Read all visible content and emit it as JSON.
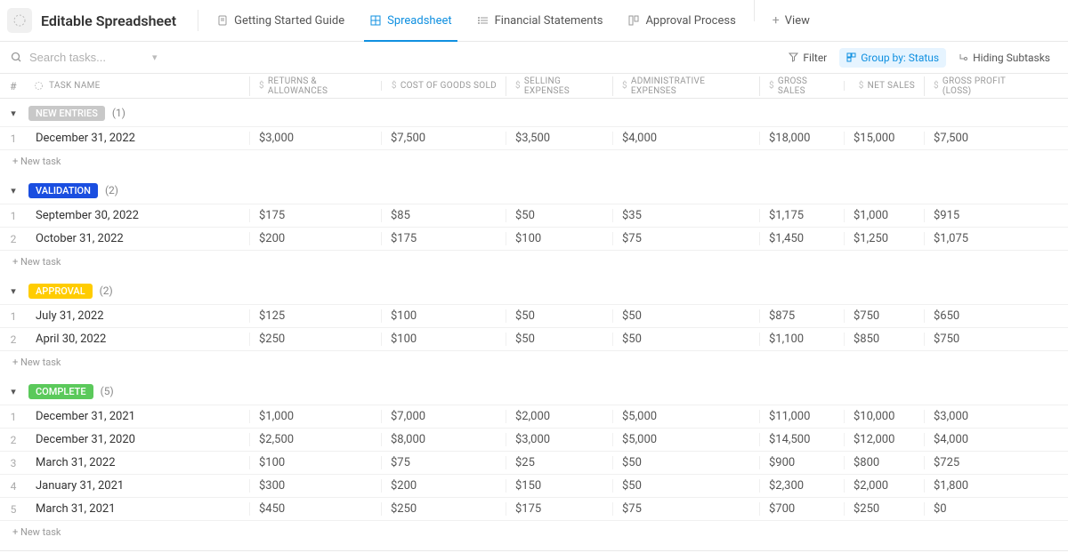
{
  "header": {
    "title": "Editable Spreadsheet",
    "tabs": [
      {
        "label": "Getting Started Guide"
      },
      {
        "label": "Spreadsheet"
      },
      {
        "label": "Financial Statements"
      },
      {
        "label": "Approval Process"
      },
      {
        "label": "View"
      }
    ]
  },
  "subbar": {
    "search_placeholder": "Search tasks...",
    "filter": "Filter",
    "groupby": "Group by: Status",
    "hiding": "Hiding Subtasks"
  },
  "columns": {
    "num": "#",
    "task": "TASK NAME",
    "ra": "RETURNS & ALLOWANCES",
    "cogs": "COST OF GOODS SOLD",
    "se": "SELLING EXPENSES",
    "ae": "ADMINISTRATIVE EXPENSES",
    "gs": "GROSS SALES",
    "ns": "NET SALES",
    "gp": "GROSS PROFIT (LOSS)"
  },
  "new_task_label": "+ New task",
  "groups": [
    {
      "name": "NEW ENTRIES",
      "badge_class": "gray",
      "count": "(1)",
      "rows": [
        {
          "n": "1",
          "task": "December 31, 2022",
          "ra": "$3,000",
          "cogs": "$7,500",
          "se": "$3,500",
          "ae": "$4,000",
          "gs": "$18,000",
          "ns": "$15,000",
          "gp": "$7,500"
        }
      ]
    },
    {
      "name": "VALIDATION",
      "badge_class": "blue",
      "count": "(2)",
      "rows": [
        {
          "n": "1",
          "task": "September 30, 2022",
          "ra": "$175",
          "cogs": "$85",
          "se": "$50",
          "ae": "$35",
          "gs": "$1,175",
          "ns": "$1,000",
          "gp": "$915"
        },
        {
          "n": "2",
          "task": "October 31, 2022",
          "ra": "$200",
          "cogs": "$175",
          "se": "$100",
          "ae": "$75",
          "gs": "$1,450",
          "ns": "$1,250",
          "gp": "$1,075"
        }
      ]
    },
    {
      "name": "APPROVAL",
      "badge_class": "yellow",
      "count": "(2)",
      "rows": [
        {
          "n": "1",
          "task": "July 31, 2022",
          "ra": "$125",
          "cogs": "$100",
          "se": "$50",
          "ae": "$50",
          "gs": "$875",
          "ns": "$750",
          "gp": "$650"
        },
        {
          "n": "2",
          "task": "April 30, 2022",
          "ra": "$250",
          "cogs": "$100",
          "se": "$50",
          "ae": "$50",
          "gs": "$1,100",
          "ns": "$850",
          "gp": "$750"
        }
      ]
    },
    {
      "name": "COMPLETE",
      "badge_class": "green",
      "count": "(5)",
      "rows": [
        {
          "n": "1",
          "task": "December 31, 2021",
          "ra": "$1,000",
          "cogs": "$7,000",
          "se": "$2,000",
          "ae": "$5,000",
          "gs": "$11,000",
          "ns": "$10,000",
          "gp": "$3,000"
        },
        {
          "n": "2",
          "task": "December 31, 2020",
          "ra": "$2,500",
          "cogs": "$8,000",
          "se": "$3,000",
          "ae": "$5,000",
          "gs": "$14,500",
          "ns": "$12,000",
          "gp": "$4,000"
        },
        {
          "n": "3",
          "task": "March 31, 2022",
          "ra": "$100",
          "cogs": "$75",
          "se": "$25",
          "ae": "$50",
          "gs": "$900",
          "ns": "$800",
          "gp": "$725"
        },
        {
          "n": "4",
          "task": "January 31, 2021",
          "ra": "$300",
          "cogs": "$200",
          "se": "$150",
          "ae": "$50",
          "gs": "$2,300",
          "ns": "$2,000",
          "gp": "$1,800"
        },
        {
          "n": "5",
          "task": "March 31, 2021",
          "ra": "$450",
          "cogs": "$250",
          "se": "$175",
          "ae": "$75",
          "gs": "$700",
          "ns": "$250",
          "gp": "$0"
        }
      ]
    }
  ]
}
